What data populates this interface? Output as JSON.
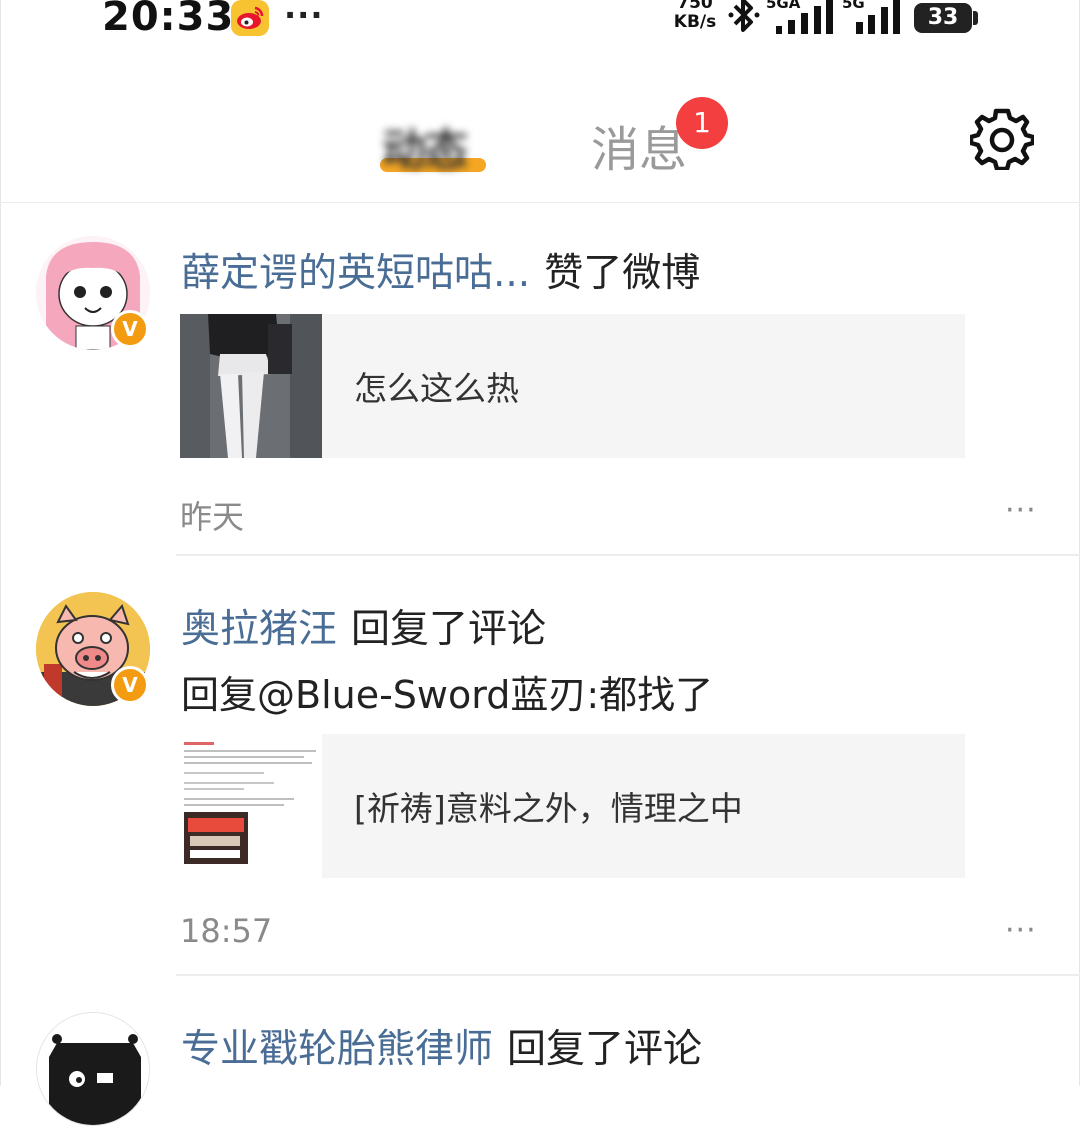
{
  "status_bar": {
    "time": "20:33",
    "more": "···",
    "speed_value": "750",
    "speed_unit": "KB/s",
    "net1": "5GA",
    "net2": "5G",
    "battery": "33"
  },
  "header": {
    "active_tab_label": "动态",
    "messages_tab_label": "消息",
    "messages_badge": "1",
    "accent_color": "#f5a623"
  },
  "feed": [
    {
      "username": "薛定谔的英短咕咕...",
      "action": "赞了微博",
      "reply": "",
      "card_text": "怎么这么热",
      "time": "昨天",
      "more": "···"
    },
    {
      "username": "奥拉猪汪",
      "action": "回复了评论",
      "reply": "回复@Blue-Sword蓝刃:都找了",
      "card_text": "[祈祷]意料之外，情理之中",
      "time": "18:57",
      "more": "···"
    },
    {
      "username": "专业戳轮胎熊律师",
      "action": "回复了评论"
    }
  ]
}
